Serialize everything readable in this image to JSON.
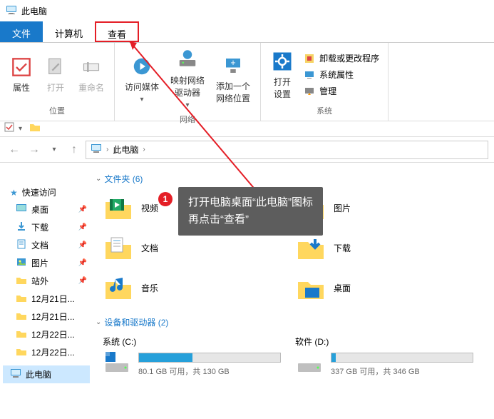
{
  "title": "此电脑",
  "tabs": {
    "file": "文件",
    "computer": "计算机",
    "view": "查看"
  },
  "ribbon": {
    "g1": {
      "props": "属性",
      "open": "打开",
      "rename": "重命名",
      "label": "位置"
    },
    "g2": {
      "media": "访问媒体",
      "mapdrive": "映射网络\n驱动器",
      "addloc": "添加一个\n网络位置",
      "label": "网络"
    },
    "g3": {
      "settings": "打开\n设置",
      "uninstall": "卸载或更改程序",
      "sysprops": "系统属性",
      "manage": "管理",
      "label": "系统"
    }
  },
  "breadcrumb": "此电脑",
  "sidebar": {
    "quick": "快速访问",
    "items": [
      {
        "label": "桌面",
        "pin": true
      },
      {
        "label": "下载",
        "pin": true
      },
      {
        "label": "文档",
        "pin": true
      },
      {
        "label": "图片",
        "pin": true
      },
      {
        "label": "站外",
        "pin": true
      },
      {
        "label": "12月21日..."
      },
      {
        "label": "12月21日..."
      },
      {
        "label": "12月22日..."
      },
      {
        "label": "12月22日..."
      }
    ],
    "thispc": "此电脑"
  },
  "groups": {
    "folders": {
      "label": "文件夹 (6)"
    },
    "drives": {
      "label": "设备和驱动器 (2)"
    }
  },
  "folders": [
    {
      "name": "视频"
    },
    {
      "name": "图片"
    },
    {
      "name": "文档"
    },
    {
      "name": "下载"
    },
    {
      "name": "音乐"
    },
    {
      "name": "桌面"
    }
  ],
  "drives": [
    {
      "name": "系统 (C:)",
      "text": "80.1 GB 可用，共 130 GB",
      "pct": 38
    },
    {
      "name": "软件 (D:)",
      "text": "337 GB 可用，共 346 GB",
      "pct": 3
    }
  ],
  "tooltip": {
    "line1": "打开电脑桌面“此电脑”图标",
    "line2": "再点击“查看”"
  },
  "badge": "1"
}
